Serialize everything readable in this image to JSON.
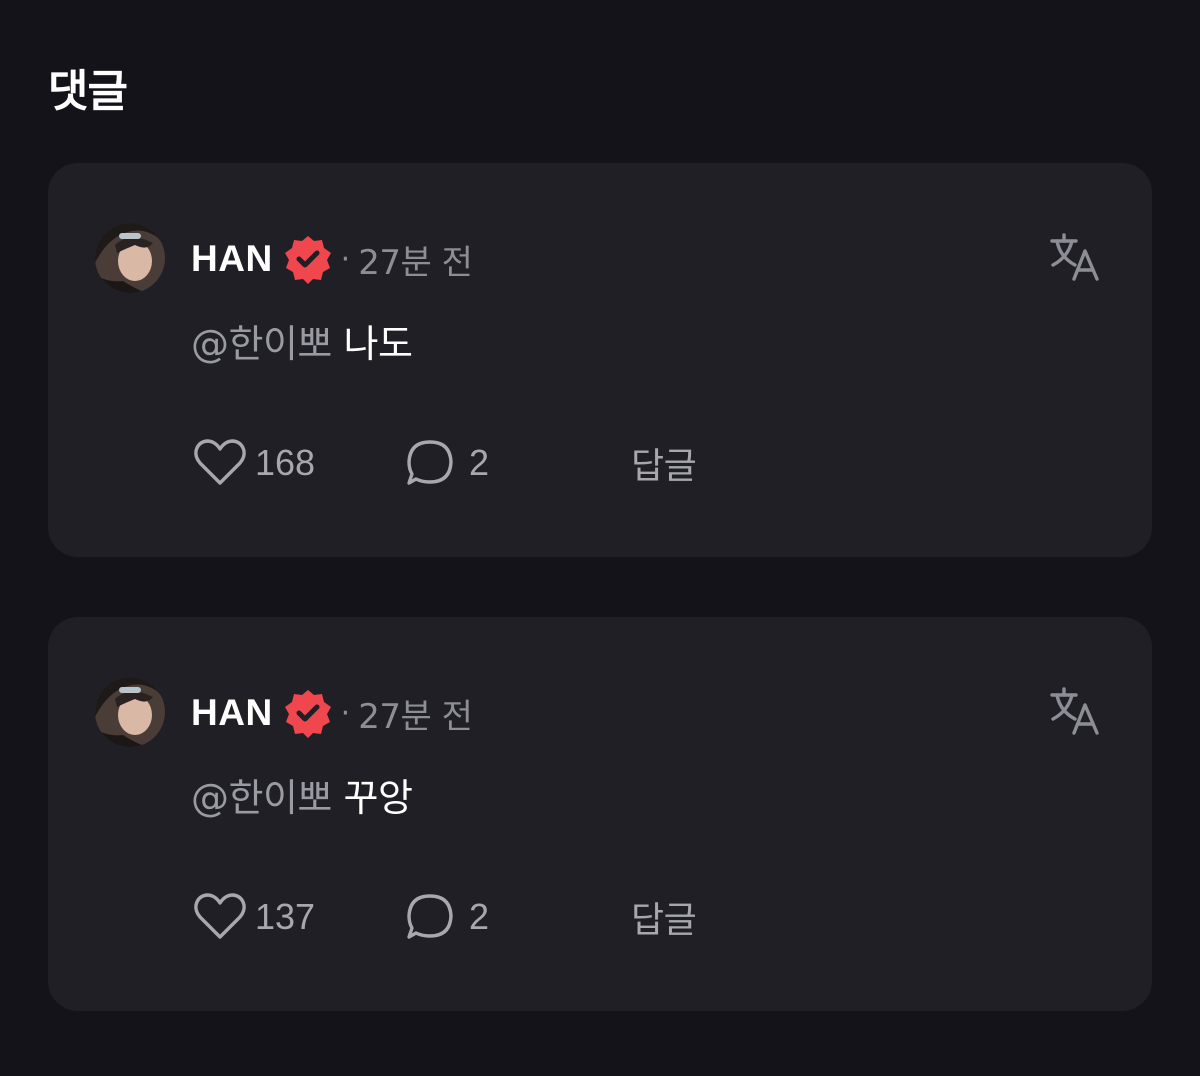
{
  "section": {
    "title": "댓글"
  },
  "comments": [
    {
      "author": "HAN",
      "time": "27분 전",
      "mention": "@한이뽀",
      "text": "나도",
      "likes": "168",
      "replies": "2",
      "reply_label": "답글"
    },
    {
      "author": "HAN",
      "time": "27분 전",
      "mention": "@한이뽀",
      "text": "꾸앙",
      "likes": "137",
      "replies": "2",
      "reply_label": "답글"
    }
  ],
  "separator": "·",
  "icons": {
    "avatar": "avatar-photo",
    "badge": "verified-badge-icon",
    "translate": "translate-icon",
    "like": "heart-icon",
    "reply": "speech-bubble-icon"
  },
  "colors": {
    "background": "#131319",
    "card": "#1f1f25",
    "badge": "#f0474f",
    "muted": "#8d8d95"
  }
}
